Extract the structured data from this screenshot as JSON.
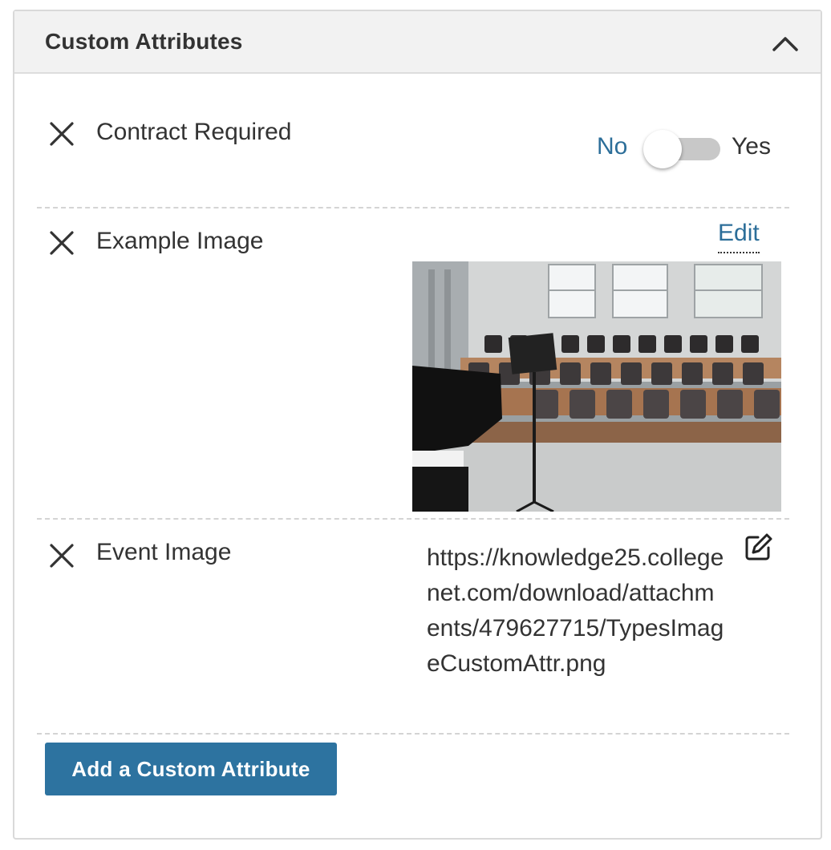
{
  "panel": {
    "title": "Custom Attributes",
    "collapse_icon": "chevron-up-icon"
  },
  "attributes": [
    {
      "label": "Contract Required",
      "remove_icon": "close-icon",
      "toggle": {
        "off_label": "No",
        "on_label": "Yes",
        "value": false
      }
    },
    {
      "label": "Example Image",
      "remove_icon": "close-icon",
      "edit_label": "Edit",
      "image_subject": "photo"
    },
    {
      "label": "Event Image",
      "remove_icon": "close-icon",
      "url": "https://knowledge25.collegenet.com/download/attachments/479627715/TypesImageCustomAttr.png",
      "edit_icon": "edit-square-icon"
    }
  ],
  "actions": {
    "add_label": "Add a Custom Attribute"
  },
  "colors": {
    "link": "#2c6e99",
    "button": "#2d73a0",
    "header_bg": "#f2f2f2",
    "divider": "#d4d4d4",
    "toggle_track": "#c8c8c8"
  }
}
